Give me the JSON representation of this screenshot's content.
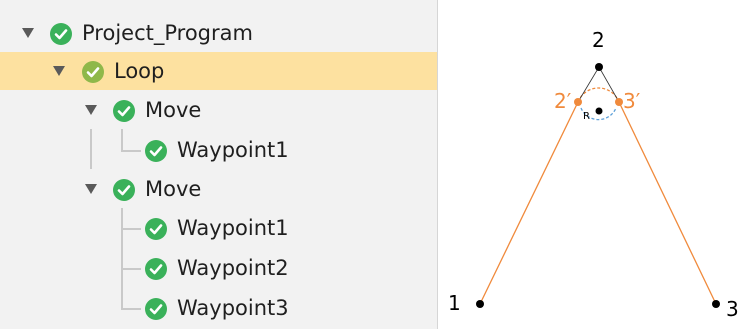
{
  "tree": {
    "nodes": [
      {
        "label": "Project_Program"
      },
      {
        "label": "Loop"
      },
      {
        "label": "Move"
      },
      {
        "label": "Waypoint1"
      },
      {
        "label": "Move"
      },
      {
        "label": "Waypoint1"
      },
      {
        "label": "Waypoint2"
      },
      {
        "label": "Waypoint3"
      }
    ]
  },
  "diagram": {
    "point_labels": {
      "p1": "1",
      "p2": "2",
      "p3": "3",
      "p2prime": "2′",
      "p3prime": "3′",
      "radius": "R"
    },
    "colors": {
      "path": "#f08a3c",
      "circle": "#5ea0d8",
      "points": "#000000"
    }
  }
}
